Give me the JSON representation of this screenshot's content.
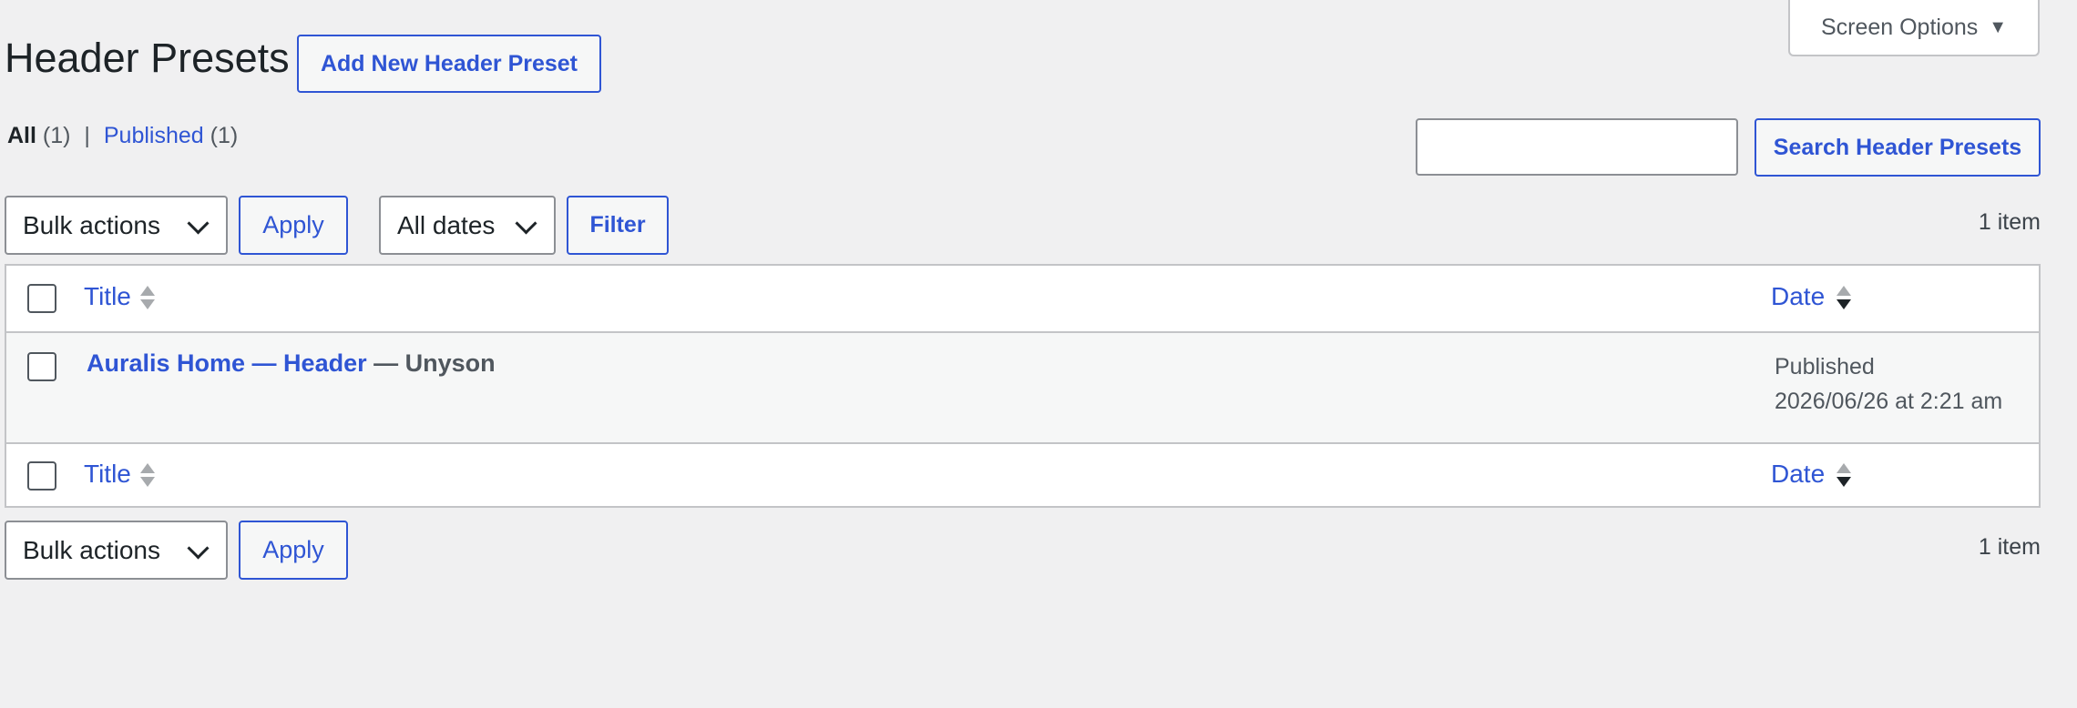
{
  "header": {
    "title": "Header Presets",
    "add_new_label": "Add New Header Preset",
    "screen_options_label": "Screen Options"
  },
  "subsubsub": {
    "all_label": "All",
    "all_count": "(1)",
    "separator": "|",
    "published_label": "Published",
    "published_count": "(1)"
  },
  "search": {
    "value": "",
    "button_label": "Search Header Presets"
  },
  "tablenav_top": {
    "bulk_actions_selected": "Bulk actions",
    "apply_label": "Apply",
    "dates_selected": "All dates",
    "filter_label": "Filter",
    "items_count": "1 item"
  },
  "table": {
    "columns": {
      "title": "Title",
      "date": "Date"
    },
    "rows": [
      {
        "title": "Auralis Home — Header",
        "state": "— Unyson",
        "status": "Published",
        "date": "2026/06/26 at 2:21 am"
      }
    ]
  },
  "tablenav_bottom": {
    "bulk_actions_selected": "Bulk actions",
    "apply_label": "Apply",
    "items_count": "1 item"
  },
  "colors": {
    "background": "#f0f0f1",
    "accent": "#2f55d4",
    "border": "#c3c4c7",
    "row_alt": "#f6f7f7"
  }
}
